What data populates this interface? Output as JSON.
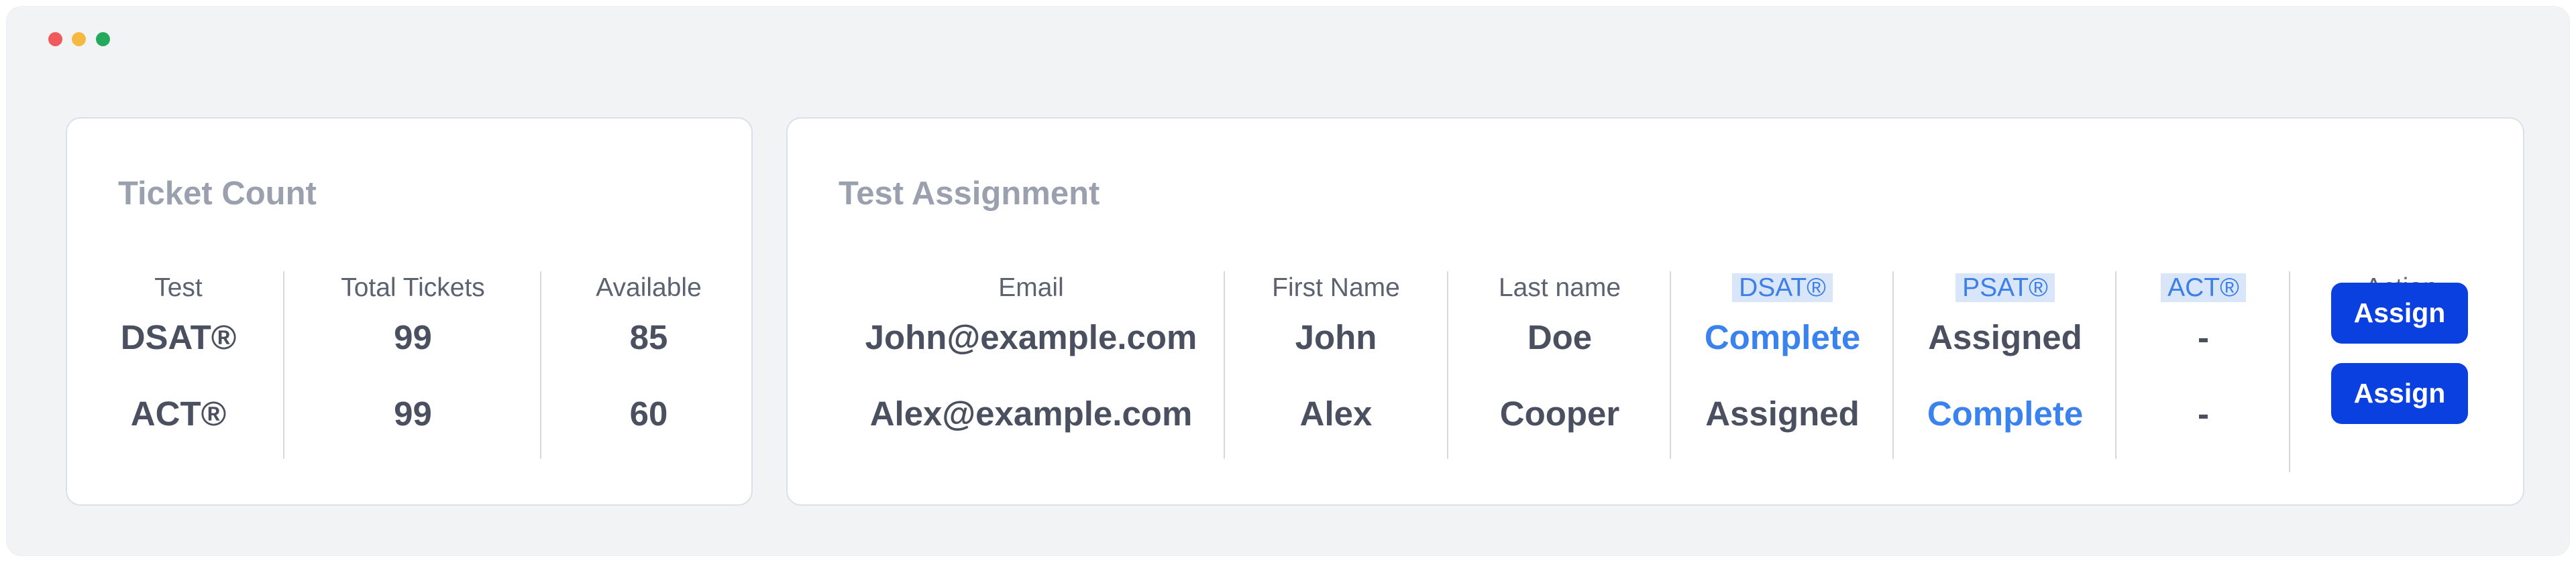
{
  "ticket_count": {
    "title": "Ticket Count",
    "headers": [
      "Test",
      "Total Tickets",
      "Available"
    ],
    "rows": [
      [
        "DSAT®",
        "99",
        "85"
      ],
      [
        "ACT®",
        "99",
        "60"
      ]
    ]
  },
  "test_assignment": {
    "title": "Test Assignment",
    "headers": [
      "Email",
      "First Name",
      "Last name",
      "DSAT®",
      "PSAT®",
      "ACT®",
      "Action"
    ],
    "rows": [
      {
        "email": "John@example.com",
        "first": "John",
        "last": "Doe",
        "dsat": "Complete",
        "psat": "Assigned",
        "act": "-",
        "action": "Assign"
      },
      {
        "email": "Alex@example.com",
        "first": "Alex",
        "last": "Cooper",
        "dsat": "Assigned",
        "psat": "Complete",
        "act": "-",
        "action": "Assign"
      }
    ]
  },
  "colors": {
    "window_bg": "#f2f3f5",
    "title_gray": "#9aa0ad",
    "complete_blue": "#3a83ee",
    "header_highlight": "#d9e6fa",
    "button_blue": "#0a3fe0"
  }
}
